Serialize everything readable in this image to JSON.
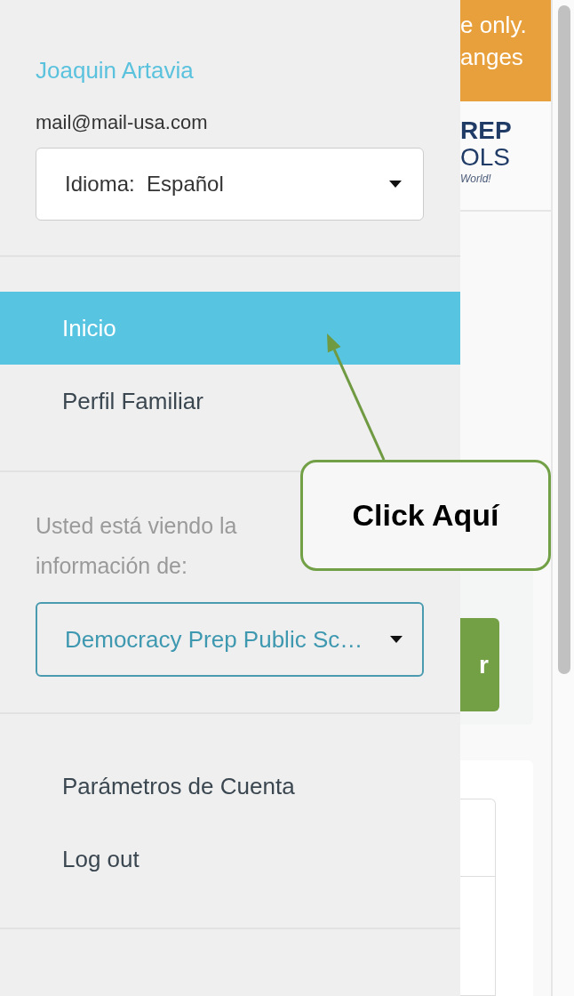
{
  "banner": {
    "lines": [
      "e only.",
      "anges"
    ]
  },
  "logo": {
    "lines": [
      "REP",
      "OLS",
      "World!"
    ]
  },
  "action_button": {
    "label": "r"
  },
  "drawer": {
    "user_name": "Joaquin Artavia",
    "email": "mail@mail-usa.com",
    "language_select": {
      "label": "Idioma:",
      "value": "Español"
    },
    "nav": [
      {
        "label": "Inicio",
        "selected": true
      },
      {
        "label": "Perfil Familiar",
        "selected": false
      }
    ],
    "viewing_label": "Usted está viendo la información de:",
    "school_select": {
      "value": "Democracy Prep Public Sc…"
    },
    "account_menu": [
      {
        "label": "Parámetros de Cuenta"
      },
      {
        "label": "Log out"
      }
    ]
  },
  "callout": {
    "text": "Click Aquí"
  }
}
